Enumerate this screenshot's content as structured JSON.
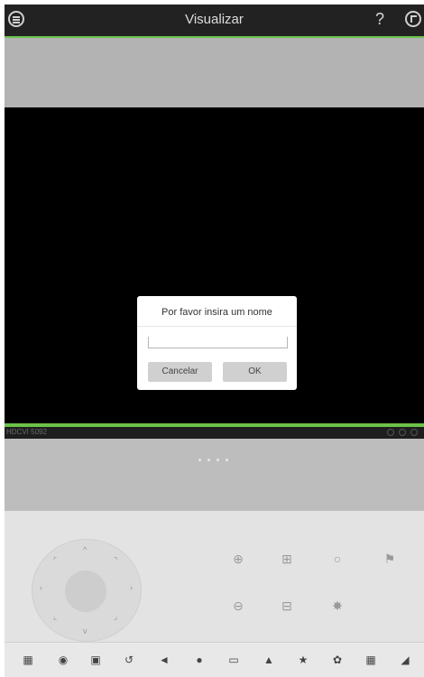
{
  "header": {
    "title": "Visualizar",
    "help_label": "?"
  },
  "channel": {
    "name": "HDCVI 5092"
  },
  "pager": {
    "count": 4
  },
  "dialog": {
    "title": "Por favor insira um nome",
    "input_value": "",
    "cancel_label": "Cancelar",
    "ok_label": "OK"
  },
  "colors": {
    "accent": "#6cc24a",
    "topbar": "#222222",
    "video": "#000000"
  },
  "ptz_icons": [
    "zoom-in-icon",
    "focus-in-icon",
    "iris-open-icon",
    "flag-icon",
    "zoom-out-icon",
    "focus-out-icon",
    "iris-close-icon"
  ],
  "toolbar_icons": [
    "channels-icon",
    "snapshot-icon",
    "record-icon",
    "playback-icon",
    "audio-icon",
    "talk-icon",
    "screen-icon",
    "alarm-icon",
    "favorite-icon",
    "color-icon",
    "stream-icon",
    "fullscreen-icon"
  ]
}
